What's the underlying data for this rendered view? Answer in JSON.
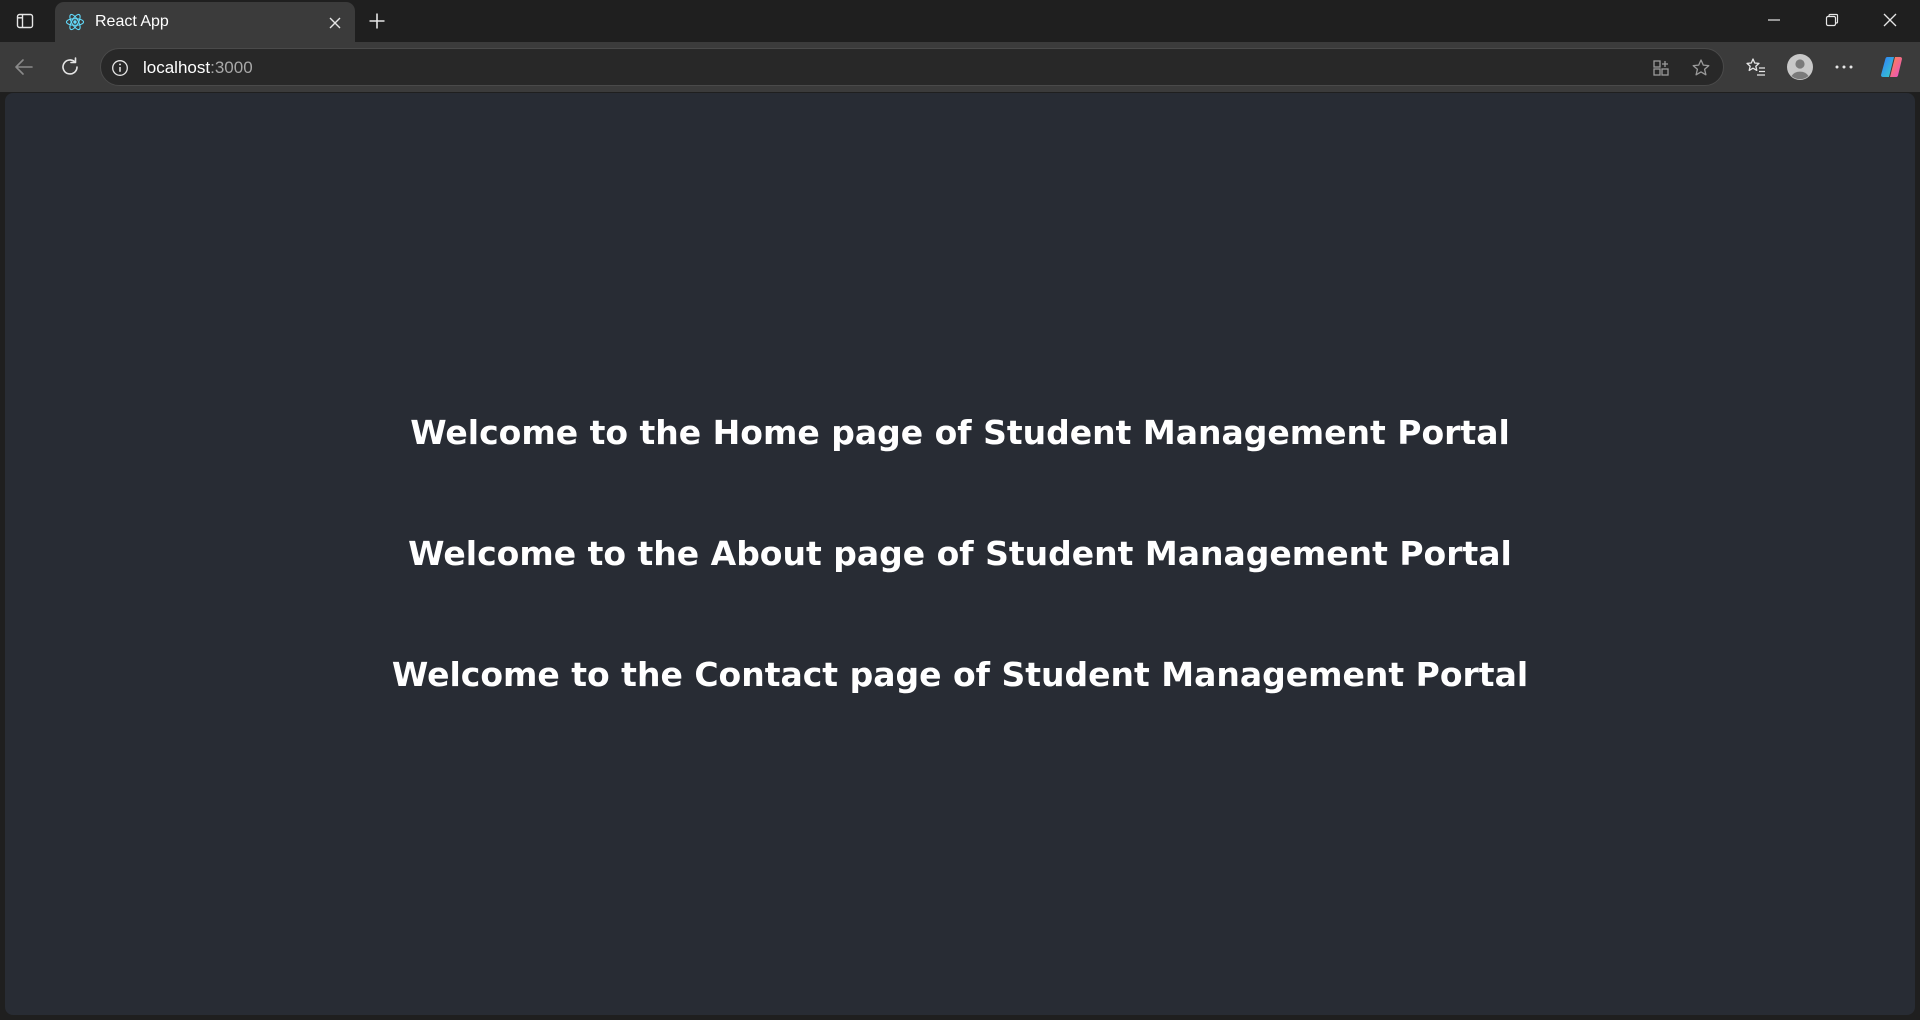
{
  "tab": {
    "title": "React App"
  },
  "toolbar": {
    "url_host": "localhost",
    "url_port": ":3000"
  },
  "page": {
    "headings": [
      "Welcome to the Home page of Student Management Portal",
      "Welcome to the About page of Student Management Portal",
      "Welcome to the Contact page of Student Management Portal"
    ]
  },
  "colors": {
    "chrome_bg": "#1f1f1f",
    "toolbar_bg": "#3b3b3b",
    "page_bg": "#282c34",
    "react_accent": "#61dafb",
    "text": "#ffffff"
  },
  "icons": {
    "tab_actions": "tab-actions-icon",
    "favicon": "react-logo-icon",
    "tab_close": "close-icon",
    "new_tab": "plus-icon",
    "minimize": "minimize-icon",
    "maximize": "restore-icon",
    "window_close": "close-icon",
    "back": "back-arrow-icon",
    "reload": "reload-icon",
    "site_info": "info-icon",
    "apps": "app-available-icon",
    "favorite": "star-icon",
    "favorites": "favorites-icon",
    "profile": "profile-icon",
    "more": "more-icon",
    "copilot": "copilot-icon"
  }
}
